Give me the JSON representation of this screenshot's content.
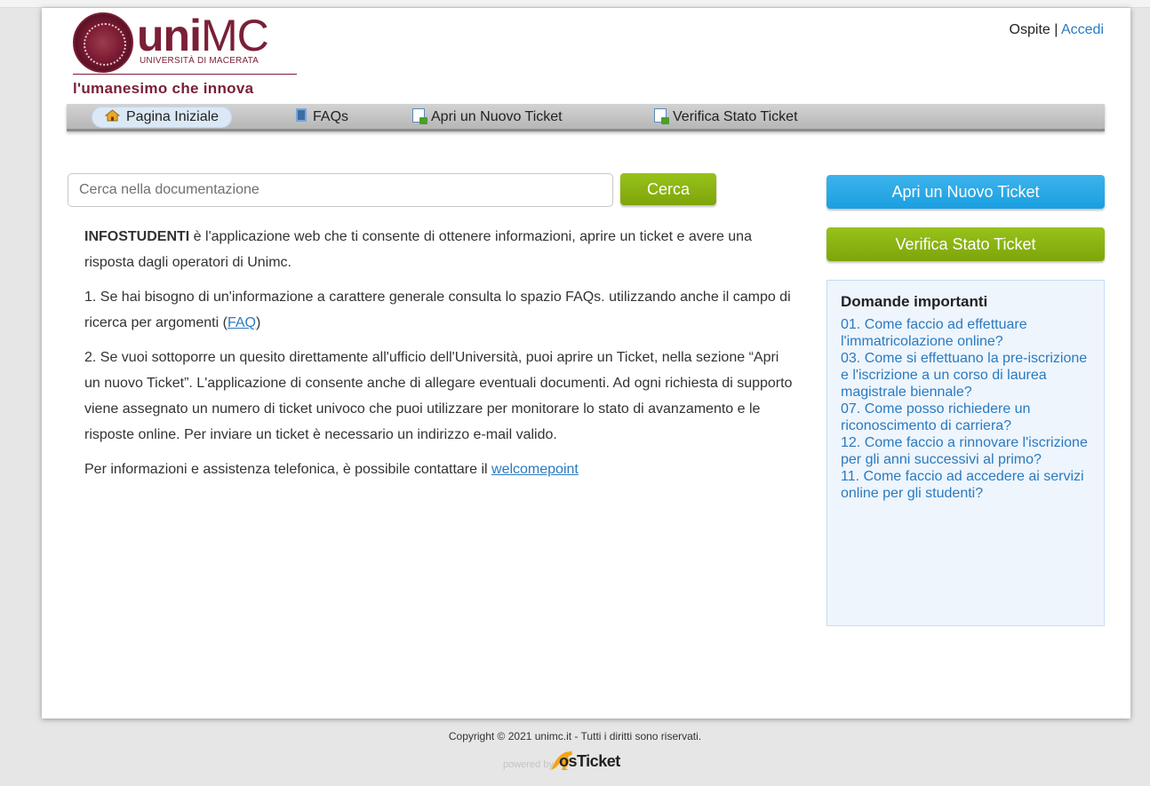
{
  "header": {
    "brand_bold": "uni",
    "brand_rest": "MC",
    "university_name": "UNIVERSITÀ DI MACERATA",
    "motto": "l'umanesimo che innova",
    "user_label": "Ospite",
    "separator": " | ",
    "login_label": "Accedi"
  },
  "nav": {
    "items": [
      {
        "label": "Pagina Iniziale",
        "icon": "home-icon"
      },
      {
        "label": "FAQs",
        "icon": "faq-icon"
      },
      {
        "label": "Apri un Nuovo Ticket",
        "icon": "new-ticket-icon"
      },
      {
        "label": "Verifica Stato Ticket",
        "icon": "check-ticket-icon"
      }
    ]
  },
  "search": {
    "placeholder": "Cerca nella documentazione",
    "value": "",
    "button_label": "Cerca"
  },
  "content": {
    "intro_bold": "INFOSTUDENTI",
    "intro_rest": " è l'applicazione web che ti consente di ottenere informazioni, aprire un ticket e avere una risposta dagli operatori di Unimc.",
    "p1_text": "1. Se hai bisogno di un'informazione a carattere generale consulta lo spazio FAQs. utilizzando anche il campo di ricerca per argomenti (",
    "p1_link": "FAQ",
    "p1_close": ")",
    "p2_text": "2. Se vuoi sottoporre un quesito direttamente all'ufficio dell'Università, puoi aprire un Ticket, nella sezione “Apri un nuovo Ticket”. L'applicazione di consente anche di allegare eventuali documenti. Ad ogni richiesta di supporto viene assegnato un numero di ticket univoco che puoi utilizzare per monitorare lo stato di avanzamento e le risposte online. Per inviare un ticket è necessario un indirizzo e-mail valido.",
    "p3_text": "Per informazioni e assistenza telefonica, è possibile contattare il ",
    "p3_link": "welcomepoint"
  },
  "sidebar": {
    "open_ticket_label": "Apri un Nuovo Ticket",
    "check_ticket_label": "Verifica Stato Ticket",
    "faq_title": "Domande importanti",
    "faqs": [
      "01. Come faccio ad effettuare l'immatricolazione online?",
      "03. Come si effettuano la pre-iscrizione e l'iscrizione a un corso di laurea magistrale biennale?",
      "07. Come posso richiedere un riconoscimento di carriera?",
      "12. Come faccio a rinnovare l'iscrizione per gli anni successivi al primo?",
      "11. Come faccio ad accedere ai servizi online per gli studenti?"
    ]
  },
  "footer": {
    "copyright": "Copyright © 2021 unimc.it - Tutti i diritti sono riservati.",
    "powered_by": "powered by",
    "product_os": "os",
    "product_ticket": "Ticket"
  },
  "colors": {
    "brand": "#7a1f36",
    "link": "#2a7ac0",
    "green_button": "#8ab514",
    "blue_button": "#2aa9e6",
    "faq_box_bg": "#eef5fc"
  }
}
